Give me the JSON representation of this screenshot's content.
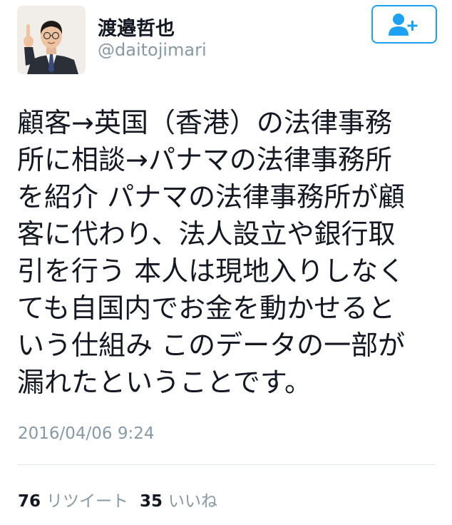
{
  "user": {
    "display_name": "渡邉哲也",
    "username": "@daitojimari"
  },
  "follow_button": {
    "icon": "add-user-icon"
  },
  "tweet": {
    "lines": [
      "顧客→英国（香港）の法律事務",
      "所に相談→パナマの法律事務所",
      "を紹介 パナマの法律事務所が顧",
      "客に代わり、法人設立や銀行取",
      "引を行う 本人は現地入りしなく",
      "ても自国内でお金を動かせると",
      "いう仕組み このデータの一部が",
      "漏れたということです。"
    ],
    "timestamp": "2016/04/06 9:24"
  },
  "stats": {
    "retweet_count": "76",
    "retweet_label": "リツイート",
    "like_count": "35",
    "like_label": "いいね"
  },
  "colors": {
    "accent": "#1da1f2",
    "secondary_text": "#8899a6",
    "primary_text": "#141823",
    "divider": "#e1e8ed"
  }
}
